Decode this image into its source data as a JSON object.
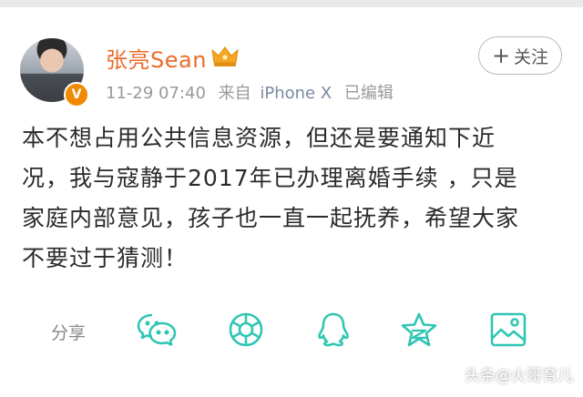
{
  "post": {
    "username": "张亮Sean",
    "time": "11-29 07:40",
    "source": "来自",
    "device": "iPhone X",
    "edited": "已编辑",
    "follow_label": "关注",
    "verified_badge": "V",
    "content_lines": [
      "本不想占用公共信息资源，但还是要通知下近",
      "况，我与寇静于2017年已办理离婚手续 ，只是",
      "家庭内部意见，孩子也一直一起抚养，希望大家",
      "不要过于猜测！"
    ]
  },
  "share": {
    "label": "分享",
    "icons": [
      "wechat-icon",
      "moments-icon",
      "qq-icon",
      "qzone-star-icon",
      "save-image-icon"
    ]
  },
  "watermark": "头条@火哥育儿",
  "colors": {
    "username": "#ea6c2b",
    "icon_teal": "#2fc6b3",
    "badge": "#f08a00",
    "crown": "#f5a623"
  }
}
